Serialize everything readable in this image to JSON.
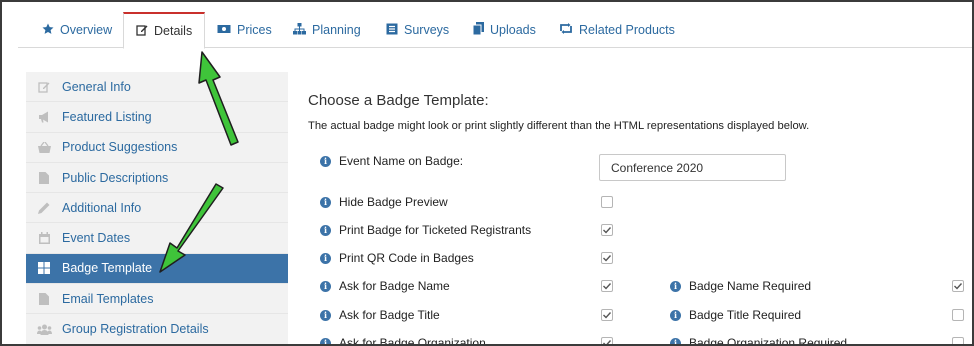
{
  "tabs": [
    {
      "label": "Overview",
      "icon": "star-icon"
    },
    {
      "label": "Details",
      "icon": "edit-icon",
      "active": true
    },
    {
      "label": "Prices",
      "icon": "money-icon"
    },
    {
      "label": "Planning",
      "icon": "sitemap-icon"
    },
    {
      "label": "Surveys",
      "icon": "list-icon"
    },
    {
      "label": "Uploads",
      "icon": "files-icon"
    },
    {
      "label": "Related Products",
      "icon": "retweet-icon"
    }
  ],
  "sidebar": {
    "items": [
      {
        "label": "General Info",
        "icon": "edit-icon"
      },
      {
        "label": "Featured Listing",
        "icon": "bullhorn-icon"
      },
      {
        "label": "Product Suggestions",
        "icon": "basket-icon"
      },
      {
        "label": "Public Descriptions",
        "icon": "file-icon"
      },
      {
        "label": "Additional Info",
        "icon": "pencil-icon"
      },
      {
        "label": "Event Dates",
        "icon": "calendar-icon"
      },
      {
        "label": "Badge Template",
        "icon": "grid-icon",
        "active": true
      },
      {
        "label": "Email Templates",
        "icon": "file-icon"
      },
      {
        "label": "Group Registration Details",
        "icon": "users-icon"
      }
    ]
  },
  "main": {
    "heading": "Choose a Badge Template:",
    "description": "The actual badge might look or print slightly different than the HTML representations displayed below.",
    "event_name_label": "Event Name on Badge:",
    "event_name_value": "Conference 2020",
    "options": [
      {
        "label": "Hide Badge Preview",
        "checked": false
      },
      {
        "label": "Print Badge for Ticketed Registrants",
        "checked": true
      },
      {
        "label": "Print QR Code in Badges",
        "checked": true
      },
      {
        "label": "Ask for Badge Name",
        "checked": true
      },
      {
        "label": "Ask for Badge Title",
        "checked": true
      },
      {
        "label": "Ask for Badge Organization",
        "checked": true
      }
    ],
    "required_options": [
      {
        "label": "Badge Name Required",
        "checked": true
      },
      {
        "label": "Badge Title Required",
        "checked": false
      },
      {
        "label": "Badge Organization Required",
        "checked": false
      }
    ]
  },
  "colors": {
    "accent": "#3c73a8",
    "link": "#2c6aa0",
    "active_tab_border": "#c9302c",
    "annotation_arrow": "#3fc43a"
  }
}
